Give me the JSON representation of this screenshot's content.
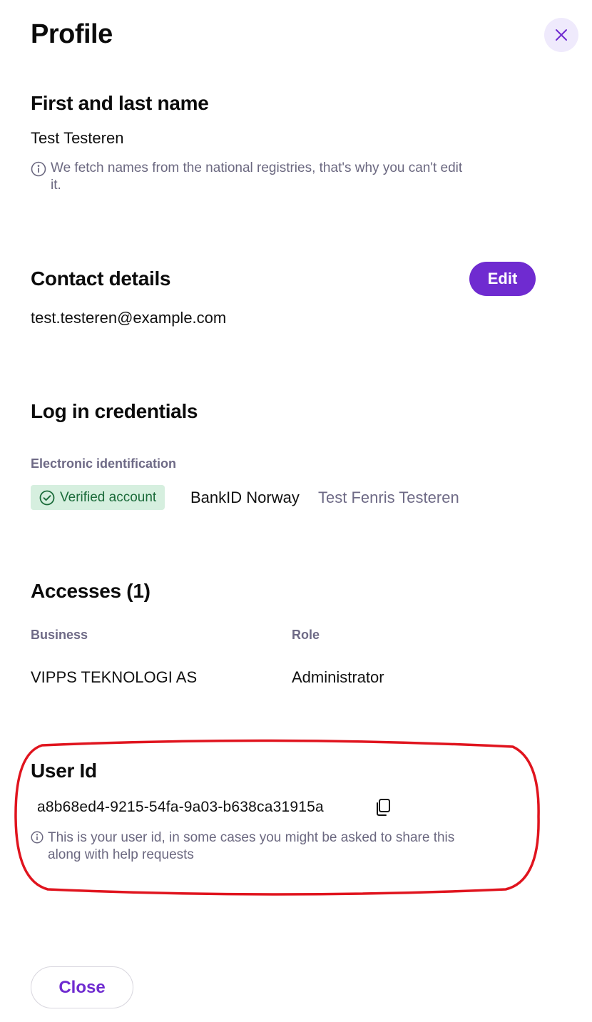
{
  "page": {
    "title": "Profile"
  },
  "name_section": {
    "heading": "First and last name",
    "value": "Test Testeren",
    "info_line1": "We fetch names from the national registries, that's why you can't edit",
    "info_line2": "it."
  },
  "contact_section": {
    "heading": "Contact details",
    "edit_label": "Edit",
    "email": "test.testeren@example.com"
  },
  "credentials_section": {
    "heading": "Log in credentials",
    "subheading": "Electronic identification",
    "badge_label": "Verified account",
    "provider": "BankID Norway",
    "provider_name": "Test Fenris Testeren"
  },
  "accesses_section": {
    "heading": "Accesses (1)",
    "columns": [
      "Business",
      "Role"
    ],
    "rows": [
      {
        "business": "VIPPS TEKNOLOGI AS",
        "role": "Administrator"
      }
    ]
  },
  "user_id_section": {
    "heading": "User Id",
    "value": "a8b68ed4-9215-54fa-9a03-b638ca31915a",
    "info_line1": "This is your user id, in some cases you might be asked to share this",
    "info_line2": "along with help requests"
  },
  "footer": {
    "close_label": "Close"
  },
  "colors": {
    "accent": "#6f2bd0",
    "close_icon_bg": "#efeafc",
    "verified_bg": "#d6efdf",
    "verified_text": "#1b6b3a",
    "muted_text": "#6e6a86",
    "annotation_red": "#e0141e"
  },
  "icons": {
    "close": "close-icon",
    "info": "info-icon",
    "verified": "check-circle-icon",
    "copy": "copy-icon"
  }
}
